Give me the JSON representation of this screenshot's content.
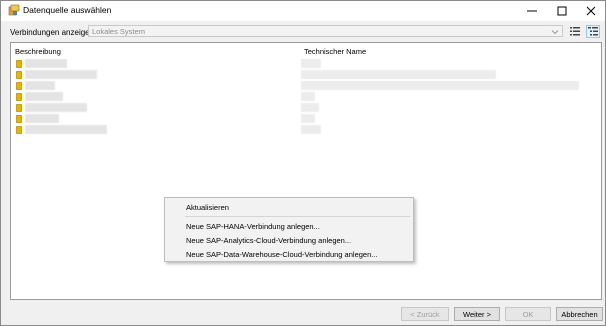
{
  "window": {
    "title": "Datenquelle auswählen"
  },
  "toolbar": {
    "label": "Verbindungen anzeigen",
    "combo_value": "Lokales System"
  },
  "list": {
    "col_description": "Beschreibung",
    "col_technical": "Technischer Name"
  },
  "context_menu": {
    "items": [
      "Aktualisieren",
      "Neue SAP-HANA-Verbindung anlegen...",
      "Neue SAP-Analytics-Cloud-Verbindung anlegen...",
      "Neue SAP-Data-Warehouse-Cloud-Verbindung anlegen..."
    ]
  },
  "buttons": {
    "back": "< Zurück",
    "next": "Weiter >",
    "ok": "OK",
    "cancel": "Abbrechen"
  },
  "colors": {
    "db_icon": "#e8b400",
    "focus_border": "#99c9ef"
  }
}
